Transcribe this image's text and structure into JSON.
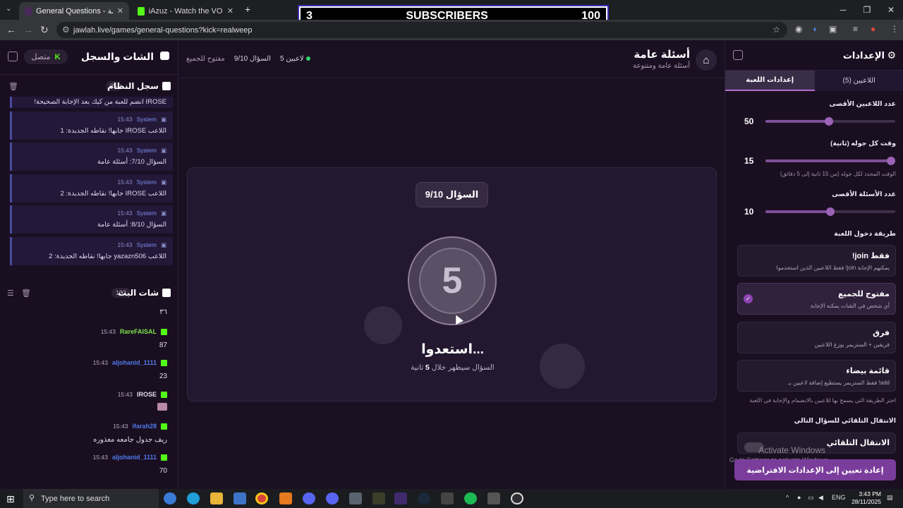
{
  "browser": {
    "tabs": [
      {
        "label": "General Questions - أسئلة عامة"
      },
      {
        "label": "iAzuz - Watch the VOD on Kick"
      }
    ],
    "url": "jawlah.live/games/general-questions?kick=realweep"
  },
  "overlay": {
    "left": "3",
    "center": "SUBSCRIBERS",
    "right": "100"
  },
  "left": {
    "title": "الشات والسجل",
    "connected": "متصل",
    "system_log": {
      "title": "سجل النظام",
      "count": "25",
      "messages": [
        {
          "time": "",
          "sender": "",
          "text": "IROSE انضم للعبة من كيك بعد الإجابة الصحيحة!"
        },
        {
          "time": "15:43",
          "sender": "System",
          "text": "اللاعب IROSE جابها! نقاطه الجديدة: 1"
        },
        {
          "time": "15:43",
          "sender": "System",
          "text": "السؤال 7/10: أسئلة عامة"
        },
        {
          "time": "15:43",
          "sender": "System",
          "text": "اللاعب IROSE جابها! نقاطه الجديدة: 2"
        },
        {
          "time": "15:43",
          "sender": "System",
          "text": "السؤال 8/10: أسئلة عامة"
        },
        {
          "time": "15:43",
          "sender": "System",
          "text": "اللاعب yazazn506 جابها! نقاطه الجديدة: 2"
        }
      ]
    },
    "stream_chat": {
      "title": "شات البث",
      "count": "102",
      "messages": [
        {
          "time": "",
          "user": "",
          "text": "٣٦",
          "color": "#e4dcea"
        },
        {
          "time": "15:43",
          "user": "RareFAISAL",
          "text": "87",
          "color": "#7ee04c"
        },
        {
          "time": "15:43",
          "user": "aljohanid_1111",
          "text": "23",
          "color": "#4f79e8"
        },
        {
          "time": "15:43",
          "user": "IROSE",
          "text": "",
          "color": "#e4dcea"
        },
        {
          "time": "15:43",
          "user": "ifarah28",
          "text": "ريف جدول جامعه معذوره",
          "color": "#4f79e8"
        },
        {
          "time": "15:43",
          "user": "aljohanid_1111",
          "text": "70",
          "color": "#4f79e8"
        }
      ]
    }
  },
  "center": {
    "title": "أسئلة عامة",
    "subtitle": "أسئلة عامة ومتنوعة",
    "players": "5 لاعبين",
    "question_progress": "السؤال 9/10",
    "mode": "مفتوح للجميع",
    "question_badge": "السؤال 9/10",
    "countdown": "5",
    "ready": "استعدوا...",
    "ready_sub_prefix": "السؤال سيظهر خلال",
    "ready_sub_num": "5",
    "ready_sub_suffix": "ثانية"
  },
  "settings": {
    "title": "الإعدادات",
    "tabs": [
      "إعدادات اللعبة",
      "اللاعبين (5)"
    ],
    "max_players": {
      "label": "عدد اللاعبين الأقصى",
      "value": "50",
      "fraction": 0.49
    },
    "round_time": {
      "label": "وقت كل جوله (ثانية)",
      "value": "15",
      "fraction": 1.0,
      "hint": "الوقت المحدد لكل جوله (من 15 ثانية إلى 5 دقائق)"
    },
    "max_questions": {
      "label": "عدد الأسئلة الأقصى",
      "value": "10",
      "fraction": 0.5
    },
    "entry_method_label": "طريقة دخول اللعبة",
    "options": [
      {
        "title": "!join فقط",
        "desc": "فقط اللاعبين الذين استخدموا !join يمكنهم الإجابة"
      },
      {
        "title": "مفتوح للجميع",
        "desc": "أي شخص في الشات يمكنه الإجابة"
      },
      {
        "title": "فرق",
        "desc": "فريقين + الستريمر يوزع اللاعبين"
      },
      {
        "title": "قائمة بيضاء",
        "desc": "فقط الستريمر يستطيع إضافة لاعبين بـ !add"
      }
    ],
    "options_hint": "اختر الطريقة التي يسمح بها للاعبين بالانضمام والإجابة في اللعبة",
    "auto_label": "الانتقال التلقائي للسؤال التالي",
    "auto_toggle_label": "الانتقال التلقائي",
    "reset": "إعادة تعيين إلى الإعدادات الافتراضية",
    "watermark_1": "Activate Windows",
    "watermark_2": "Go to Settings to activate Windows."
  },
  "taskbar": {
    "search_placeholder": "Type here to search",
    "lang": "ENG",
    "time": "3:43 PM",
    "date": "28/11/2025"
  }
}
